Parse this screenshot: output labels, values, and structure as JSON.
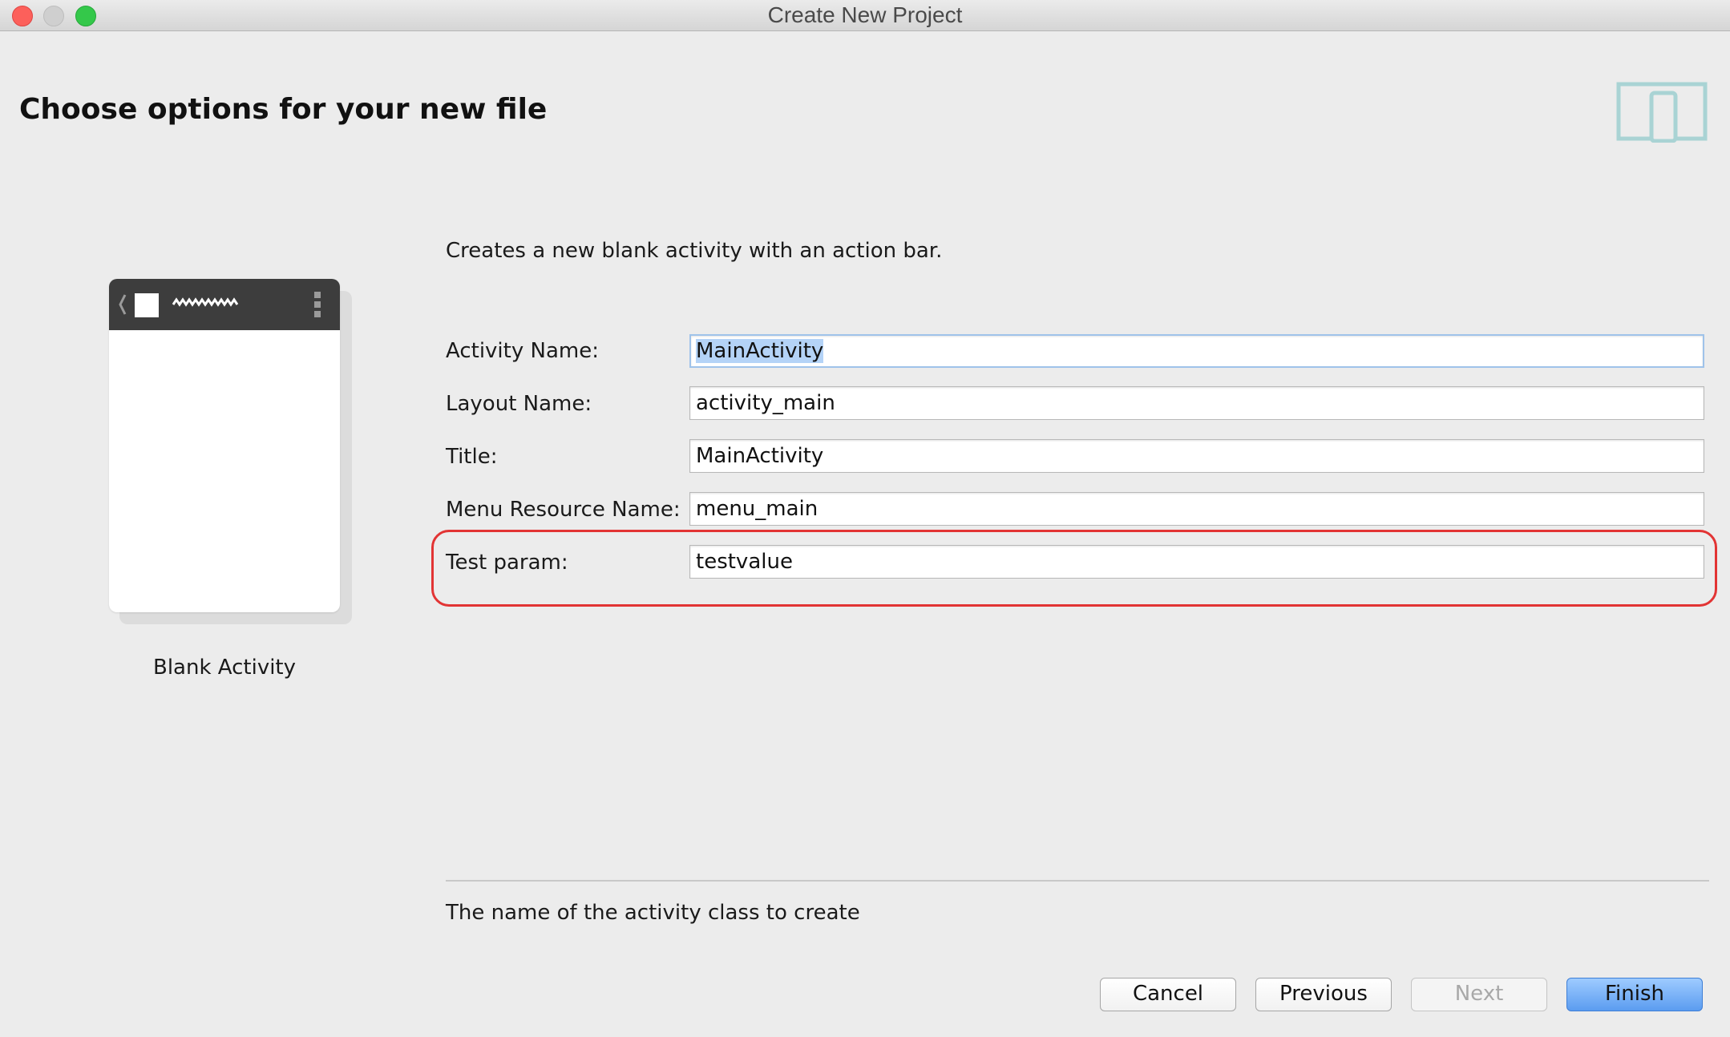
{
  "window": {
    "title": "Create New Project"
  },
  "header": {
    "title": "Choose options for your new file"
  },
  "template": {
    "name": "Blank Activity"
  },
  "description": "Creates a new blank activity with an action bar.",
  "form": {
    "fields": [
      {
        "label": "Activity Name:",
        "value": "MainActivity"
      },
      {
        "label": "Layout Name:",
        "value": "activity_main"
      },
      {
        "label": "Title:",
        "value": "MainActivity"
      },
      {
        "label": "Menu Resource Name:",
        "value": "menu_main"
      },
      {
        "label": "Test param:",
        "value": "testvalue"
      }
    ]
  },
  "help_text": "The name of the activity class to create",
  "buttons": {
    "cancel": "Cancel",
    "previous": "Previous",
    "next": "Next",
    "finish": "Finish"
  },
  "colors": {
    "highlight_border": "#e23434",
    "finish_button": "#5b9cf0",
    "selection": "#b4d3f7",
    "device_icon": "#a9d3d4"
  },
  "icons": [
    "device-outline-icon",
    "back-chevron-icon",
    "app-icon",
    "overflow-menu-icon"
  ]
}
